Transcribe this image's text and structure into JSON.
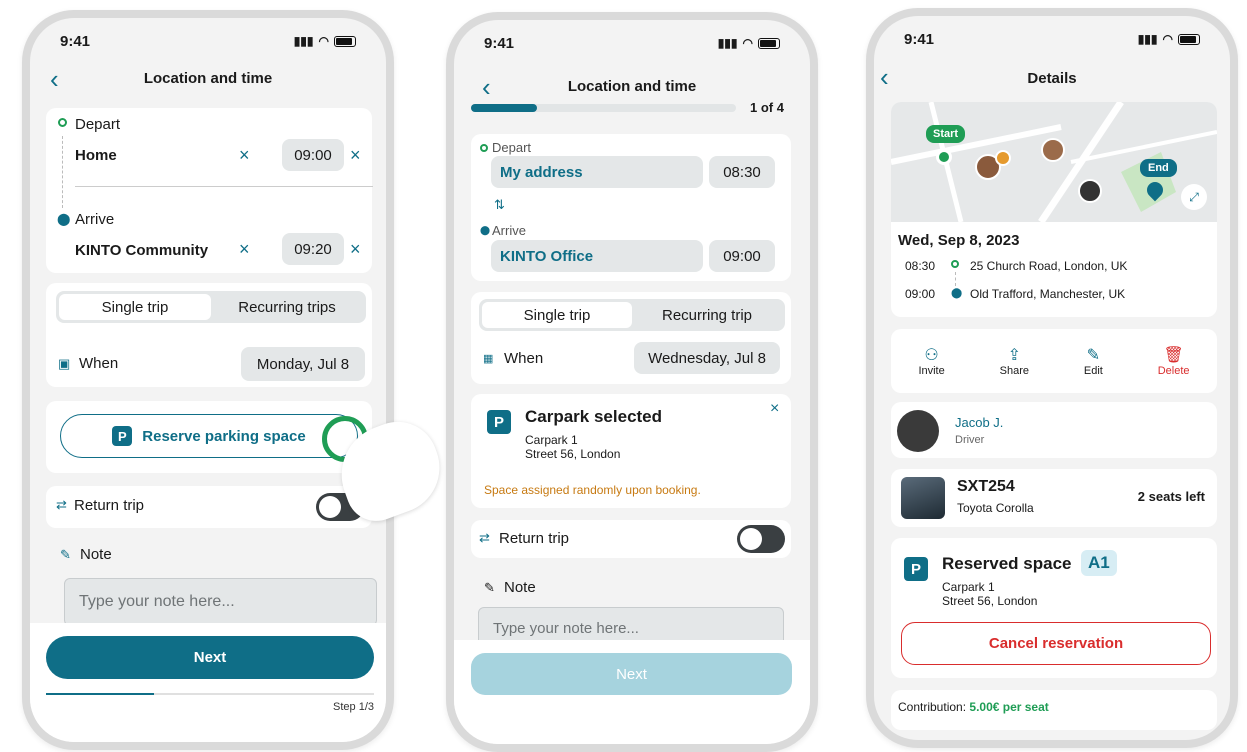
{
  "status_time": "9:41",
  "phone1": {
    "title": "Location and time",
    "depart_label": "Depart",
    "depart_value": "Home",
    "depart_time": "09:00",
    "arrive_label": "Arrive",
    "arrive_value": "KINTO Community",
    "arrive_time": "09:20",
    "seg_single": "Single trip",
    "seg_recurring": "Recurring trips",
    "when_label": "When",
    "when_value": "Monday, Jul 8",
    "reserve_label": "Reserve parking space",
    "return_label": "Return trip",
    "note_label": "Note",
    "note_placeholder": "Type your note here...",
    "next_label": "Next",
    "step_label": "Step 1/3",
    "step_progress": 0.33
  },
  "phone2": {
    "title": "Location and time",
    "progress_label": "1 of 4",
    "progress": 0.25,
    "depart_label": "Depart",
    "depart_value": "My address",
    "depart_time": "08:30",
    "arrive_label": "Arrive",
    "arrive_value": "KINTO Office",
    "arrive_time": "09:00",
    "seg_single": "Single trip",
    "seg_recurring": "Recurring trip",
    "when_label": "When",
    "when_value": "Wednesday, Jul 8",
    "carpark_title": "Carpark selected",
    "carpark_name": "Carpark 1",
    "carpark_street": "Street 56, London",
    "carpark_note": "Space assigned randomly upon booking.",
    "return_label": "Return trip",
    "note_label": "Note",
    "note_placeholder": "Type your note here...",
    "next_label": "Next"
  },
  "phone3": {
    "title": "Details",
    "map_start": "Start",
    "map_end": "End",
    "date": "Wed, Sep 8, 2023",
    "stop1_time": "08:30",
    "stop1_address": "25 Church Road, London, UK",
    "stop2_time": "09:00",
    "stop2_address": "Old Trafford, Manchester, UK",
    "action_invite": "Invite",
    "action_share": "Share",
    "action_edit": "Edit",
    "action_delete": "Delete",
    "driver_name": "Jacob J.",
    "driver_role": "Driver",
    "car_plate": "SXT254",
    "car_model": "Toyota Corolla",
    "seats_left": "2 seats left",
    "reserved_title": "Reserved space",
    "reserved_spot": "A1",
    "carpark_name": "Carpark 1",
    "carpark_street": "Street 56, London",
    "cancel_label": "Cancel reservation",
    "contribution_label": "Contribution:",
    "contribution_value": "5.00€ per seat"
  },
  "colors": {
    "accent": "#0f6e87",
    "danger": "#d92d2d",
    "green": "#1f9d55",
    "warning": "#c77a12"
  }
}
